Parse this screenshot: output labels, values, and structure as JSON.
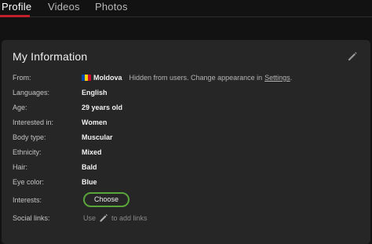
{
  "tabs": [
    {
      "label": "Profile",
      "active": true
    },
    {
      "label": "Videos",
      "active": false
    },
    {
      "label": "Photos",
      "active": false
    }
  ],
  "card": {
    "title": "My Information",
    "edit_icon": "pencil-icon"
  },
  "fields": {
    "from": {
      "label": "From:",
      "country": "Moldova",
      "flag_colors": [
        "#0046ae",
        "#ffd200",
        "#cc092f"
      ],
      "note": "Hidden from users. Change appearance in",
      "link": "Settings",
      "suffix": "."
    },
    "languages": {
      "label": "Languages:",
      "value": "English"
    },
    "age": {
      "label": "Age:",
      "value": "29 years old"
    },
    "interested_in": {
      "label": "Interested in:",
      "value": "Women"
    },
    "body_type": {
      "label": "Body type:",
      "value": "Muscular"
    },
    "ethnicity": {
      "label": "Ethnicity:",
      "value": "Mixed"
    },
    "hair": {
      "label": "Hair:",
      "value": "Bald"
    },
    "eye_color": {
      "label": "Eye color:",
      "value": "Blue"
    },
    "interests": {
      "label": "Interests:",
      "button": "Choose"
    },
    "social_links": {
      "label": "Social links:",
      "prefix": "Use",
      "suffix": "to add links"
    }
  },
  "colors": {
    "background": "#121212",
    "card": "#262626",
    "accent_red": "#c0202c",
    "button_border": "#5aa53a"
  }
}
